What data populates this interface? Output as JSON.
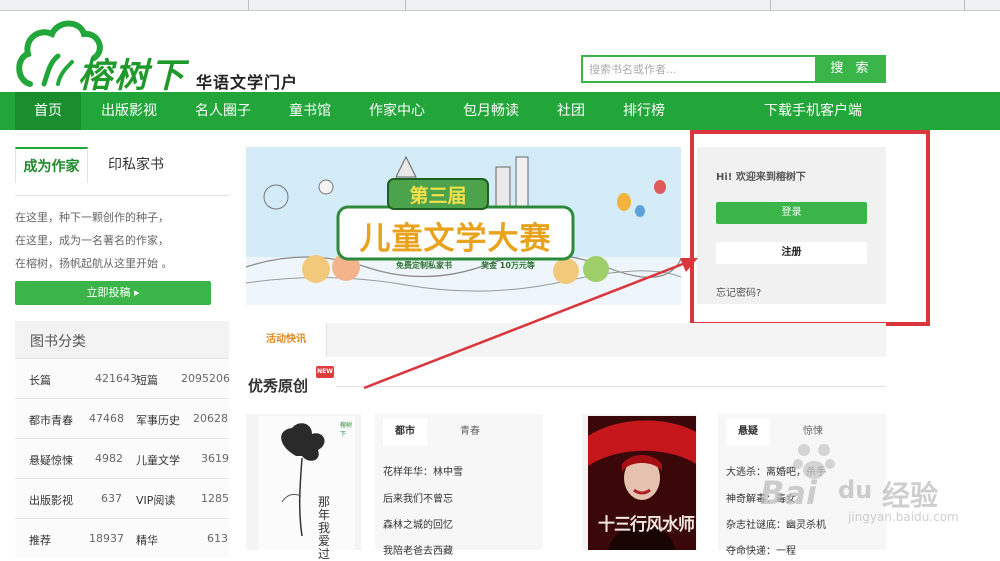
{
  "site": {
    "logo_text": "榕树下",
    "tagline": "华语文学门户"
  },
  "search": {
    "placeholder": "搜索书名或作者...",
    "button_label": "搜 索"
  },
  "nav": {
    "items": [
      {
        "label": "首页"
      },
      {
        "label": "出版影视"
      },
      {
        "label": "名人圈子"
      },
      {
        "label": "童书馆"
      },
      {
        "label": "作家中心"
      },
      {
        "label": "包月畅读"
      },
      {
        "label": "社团"
      },
      {
        "label": "排行榜"
      },
      {
        "label": "下载手机客户端"
      }
    ]
  },
  "writer": {
    "tab_active": "成为作家",
    "tab_other": "印私家书",
    "lines": [
      "在这里，种下一颗创作的种子，",
      "在这里，成为一名著名的作家，",
      "在榕树，扬帆起航从这里开始 。"
    ],
    "submit_label": "立即投稿 ▸"
  },
  "categories": {
    "title": "图书分类",
    "rows": [
      {
        "left_name": "长篇",
        "left_count": "421643",
        "right_name": "短篇",
        "right_count": "2095206"
      },
      {
        "left_name": "都市青春",
        "left_count": "47468",
        "right_name": "军事历史",
        "right_count": "20628"
      },
      {
        "left_name": "悬疑惊悚",
        "left_count": "4982",
        "right_name": "儿童文学",
        "right_count": "3619"
      },
      {
        "left_name": "出版影视",
        "left_count": "637",
        "right_name": "VIP阅读",
        "right_count": "1285"
      },
      {
        "left_name": "推荐",
        "left_count": "18937",
        "right_name": "精华",
        "right_count": "613"
      }
    ]
  },
  "banner": {
    "badge": "第三届",
    "title": "儿童文学大赛",
    "subline_left": "免费定制私家书",
    "subline_right": "奖金 10万元等"
  },
  "login": {
    "greeting": "Hi! 欢迎来到榕树下",
    "login_label": "登录",
    "register_label": "注册",
    "forgot_label": "忘记密码?"
  },
  "news": {
    "tab_label": "活动快讯"
  },
  "featured": {
    "title": "优秀原创",
    "badge": "NEW",
    "list1": {
      "tab_active": "都市",
      "tab_other": "青春",
      "items": [
        "花样年华：林中雪",
        "后来我们不曾忘",
        "森林之城的回忆",
        "我陪老爸去西藏"
      ]
    },
    "list2": {
      "tab_active": "悬疑",
      "tab_other": "惊悚",
      "items": [
        "大逃杀：离婚吧，杀手",
        "神奇解毒：毒女",
        "杂志社谜底：幽灵杀机",
        "夺命快递：一程"
      ]
    },
    "book1": {
      "title_text": "那年我爱过",
      "publisher_mark": "榕树下"
    },
    "book2": {
      "title_text": "十三行风水师"
    }
  },
  "watermark": {
    "brand": "Bai",
    "brand_suffix": "du",
    "cn": "经验",
    "url": "jingyan.baidu.com"
  },
  "colors": {
    "brand_green": "#22a63a",
    "button_green": "#3bb54a",
    "highlight_red": "#d9363e",
    "news_orange": "#e08a1e"
  }
}
